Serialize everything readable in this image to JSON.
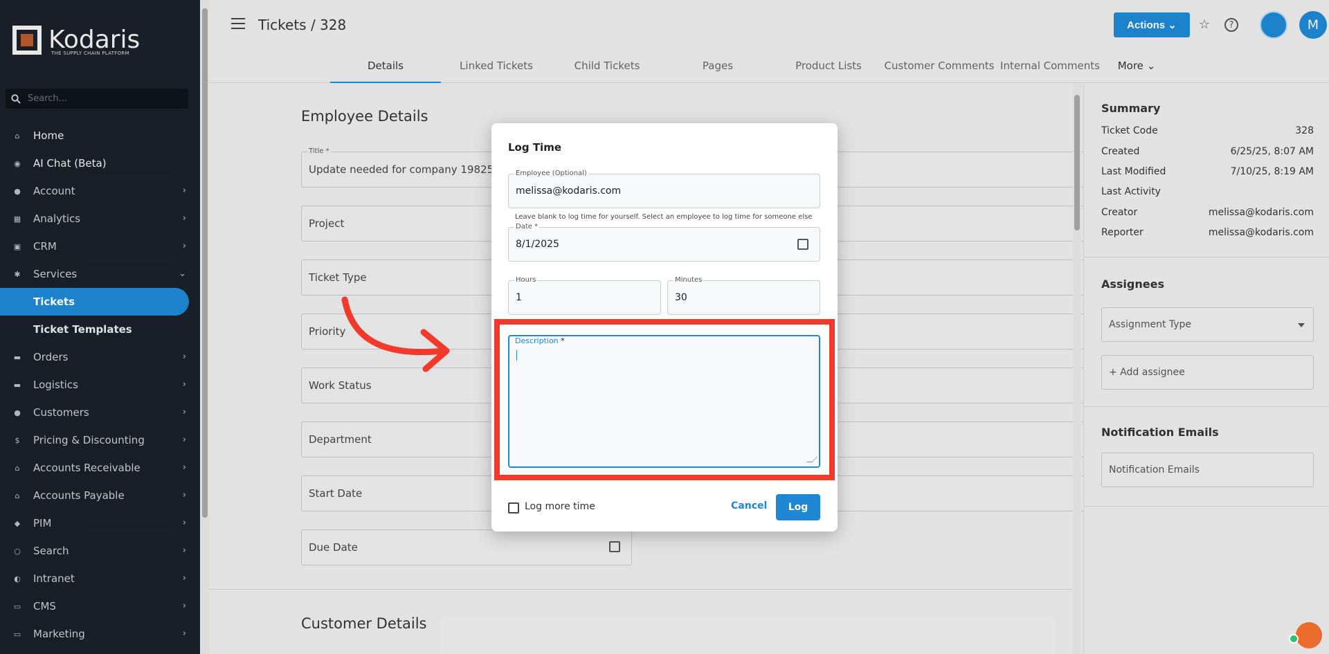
{
  "app": {
    "logo_text": "Kodaris",
    "logo_tagline": "THE SUPPLY CHAIN PLATFORM"
  },
  "sidebar": {
    "search_placeholder": "Search...",
    "items": [
      {
        "label": "Home",
        "icon": "home-icon"
      },
      {
        "label": "AI Chat (Beta)",
        "icon": "robot-icon"
      },
      {
        "label": "Account",
        "icon": "person-icon"
      },
      {
        "label": "Analytics",
        "icon": "analytics-icon"
      },
      {
        "label": "CRM",
        "icon": "crm-icon"
      },
      {
        "label": "Services",
        "icon": "services-icon"
      },
      {
        "label": "Tickets"
      },
      {
        "label": "Ticket Templates"
      },
      {
        "label": "Orders",
        "icon": "truck-icon"
      },
      {
        "label": "Logistics",
        "icon": "logistics-icon"
      },
      {
        "label": "Customers",
        "icon": "people-icon"
      },
      {
        "label": "Pricing & Discounting",
        "icon": "dollar-icon"
      },
      {
        "label": "Accounts Receivable",
        "icon": "bank-icon"
      },
      {
        "label": "Accounts Payable",
        "icon": "bank-icon"
      },
      {
        "label": "PIM",
        "icon": "tag-icon"
      },
      {
        "label": "Search",
        "icon": "search-icon"
      },
      {
        "label": "Intranet",
        "icon": "globe-icon"
      },
      {
        "label": "CMS",
        "icon": "cms-icon"
      },
      {
        "label": "Marketing",
        "icon": "marketing-icon"
      }
    ]
  },
  "header": {
    "title": "Tickets / 328",
    "actions_label": "Actions",
    "avatar_initial": "M",
    "tabs": [
      "Details",
      "Linked Tickets",
      "Child Tickets",
      "Pages",
      "Product Lists",
      "Customer Comments",
      "Internal Comments",
      "More"
    ]
  },
  "main": {
    "employee_section": "Employee Details",
    "title_label": "Title *",
    "title_value": "Update needed for company 19825",
    "project": "Project",
    "ticket_type": "Ticket Type",
    "priority": "Priority",
    "work_status": "Work Status",
    "department": "Department",
    "start_date": "Start Date",
    "due_date": "Due Date",
    "customer_section": "Customer Details"
  },
  "summary": {
    "title": "Summary",
    "rows": [
      {
        "k": "Ticket Code",
        "v": "328"
      },
      {
        "k": "Created",
        "v": "6/25/25, 8:07 AM"
      },
      {
        "k": "Last Modified",
        "v": "7/10/25, 8:19 AM"
      },
      {
        "k": "Last Activity",
        "v": ""
      },
      {
        "k": "Creator",
        "v": "melissa@kodaris.com"
      },
      {
        "k": "Reporter",
        "v": "melissa@kodaris.com"
      }
    ],
    "assignees_title": "Assignees",
    "assignment_type": "Assignment Type",
    "add_assignee": "+ Add assignee",
    "notification_title": "Notification Emails",
    "notification_placeholder": "Notification Emails"
  },
  "modal": {
    "title": "Log Time",
    "employee_label": "Employee (Optional)",
    "employee_value": "melissa@kodaris.com",
    "helper": "Leave blank to log time for yourself. Select an employee to log time for someone else",
    "date_label": "Date *",
    "date_value": "8/1/2025",
    "hours_label": "Hours",
    "hours_value": "1",
    "minutes_label": "Minutes",
    "minutes_value": "30",
    "description_label": "Description",
    "description_required": "*",
    "description_value": "",
    "log_more_label": "Log more time",
    "cancel_label": "Cancel",
    "log_label": "Log"
  },
  "colors": {
    "accent": "#1e88d4",
    "sidebar_bg": "#1b2129",
    "annotation": "#f23a2c"
  }
}
